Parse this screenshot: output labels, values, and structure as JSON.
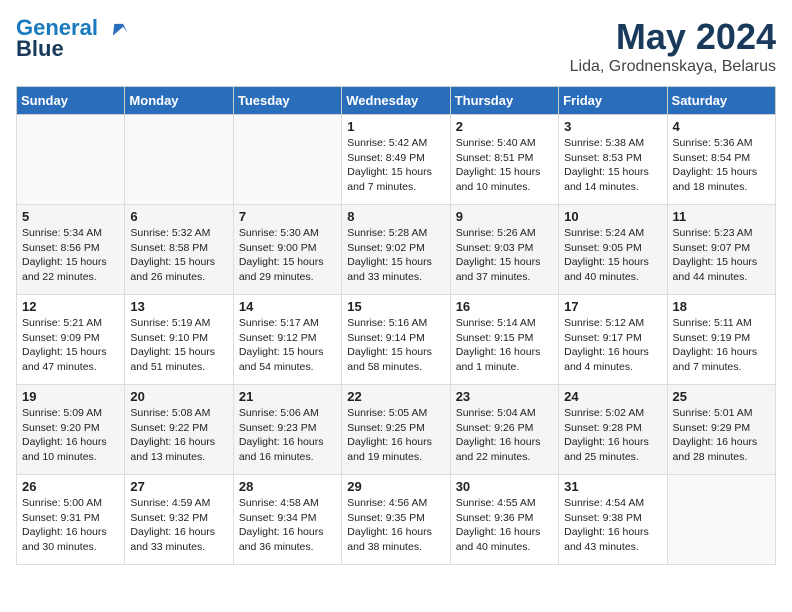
{
  "logo": {
    "line1": "General",
    "line2": "Blue"
  },
  "title": "May 2024",
  "location": "Lida, Grodnenskaya, Belarus",
  "headers": [
    "Sunday",
    "Monday",
    "Tuesday",
    "Wednesday",
    "Thursday",
    "Friday",
    "Saturday"
  ],
  "weeks": [
    [
      {
        "num": "",
        "info": ""
      },
      {
        "num": "",
        "info": ""
      },
      {
        "num": "",
        "info": ""
      },
      {
        "num": "1",
        "info": "Sunrise: 5:42 AM\nSunset: 8:49 PM\nDaylight: 15 hours\nand 7 minutes."
      },
      {
        "num": "2",
        "info": "Sunrise: 5:40 AM\nSunset: 8:51 PM\nDaylight: 15 hours\nand 10 minutes."
      },
      {
        "num": "3",
        "info": "Sunrise: 5:38 AM\nSunset: 8:53 PM\nDaylight: 15 hours\nand 14 minutes."
      },
      {
        "num": "4",
        "info": "Sunrise: 5:36 AM\nSunset: 8:54 PM\nDaylight: 15 hours\nand 18 minutes."
      }
    ],
    [
      {
        "num": "5",
        "info": "Sunrise: 5:34 AM\nSunset: 8:56 PM\nDaylight: 15 hours\nand 22 minutes."
      },
      {
        "num": "6",
        "info": "Sunrise: 5:32 AM\nSunset: 8:58 PM\nDaylight: 15 hours\nand 26 minutes."
      },
      {
        "num": "7",
        "info": "Sunrise: 5:30 AM\nSunset: 9:00 PM\nDaylight: 15 hours\nand 29 minutes."
      },
      {
        "num": "8",
        "info": "Sunrise: 5:28 AM\nSunset: 9:02 PM\nDaylight: 15 hours\nand 33 minutes."
      },
      {
        "num": "9",
        "info": "Sunrise: 5:26 AM\nSunset: 9:03 PM\nDaylight: 15 hours\nand 37 minutes."
      },
      {
        "num": "10",
        "info": "Sunrise: 5:24 AM\nSunset: 9:05 PM\nDaylight: 15 hours\nand 40 minutes."
      },
      {
        "num": "11",
        "info": "Sunrise: 5:23 AM\nSunset: 9:07 PM\nDaylight: 15 hours\nand 44 minutes."
      }
    ],
    [
      {
        "num": "12",
        "info": "Sunrise: 5:21 AM\nSunset: 9:09 PM\nDaylight: 15 hours\nand 47 minutes."
      },
      {
        "num": "13",
        "info": "Sunrise: 5:19 AM\nSunset: 9:10 PM\nDaylight: 15 hours\nand 51 minutes."
      },
      {
        "num": "14",
        "info": "Sunrise: 5:17 AM\nSunset: 9:12 PM\nDaylight: 15 hours\nand 54 minutes."
      },
      {
        "num": "15",
        "info": "Sunrise: 5:16 AM\nSunset: 9:14 PM\nDaylight: 15 hours\nand 58 minutes."
      },
      {
        "num": "16",
        "info": "Sunrise: 5:14 AM\nSunset: 9:15 PM\nDaylight: 16 hours\nand 1 minute."
      },
      {
        "num": "17",
        "info": "Sunrise: 5:12 AM\nSunset: 9:17 PM\nDaylight: 16 hours\nand 4 minutes."
      },
      {
        "num": "18",
        "info": "Sunrise: 5:11 AM\nSunset: 9:19 PM\nDaylight: 16 hours\nand 7 minutes."
      }
    ],
    [
      {
        "num": "19",
        "info": "Sunrise: 5:09 AM\nSunset: 9:20 PM\nDaylight: 16 hours\nand 10 minutes."
      },
      {
        "num": "20",
        "info": "Sunrise: 5:08 AM\nSunset: 9:22 PM\nDaylight: 16 hours\nand 13 minutes."
      },
      {
        "num": "21",
        "info": "Sunrise: 5:06 AM\nSunset: 9:23 PM\nDaylight: 16 hours\nand 16 minutes."
      },
      {
        "num": "22",
        "info": "Sunrise: 5:05 AM\nSunset: 9:25 PM\nDaylight: 16 hours\nand 19 minutes."
      },
      {
        "num": "23",
        "info": "Sunrise: 5:04 AM\nSunset: 9:26 PM\nDaylight: 16 hours\nand 22 minutes."
      },
      {
        "num": "24",
        "info": "Sunrise: 5:02 AM\nSunset: 9:28 PM\nDaylight: 16 hours\nand 25 minutes."
      },
      {
        "num": "25",
        "info": "Sunrise: 5:01 AM\nSunset: 9:29 PM\nDaylight: 16 hours\nand 28 minutes."
      }
    ],
    [
      {
        "num": "26",
        "info": "Sunrise: 5:00 AM\nSunset: 9:31 PM\nDaylight: 16 hours\nand 30 minutes."
      },
      {
        "num": "27",
        "info": "Sunrise: 4:59 AM\nSunset: 9:32 PM\nDaylight: 16 hours\nand 33 minutes."
      },
      {
        "num": "28",
        "info": "Sunrise: 4:58 AM\nSunset: 9:34 PM\nDaylight: 16 hours\nand 36 minutes."
      },
      {
        "num": "29",
        "info": "Sunrise: 4:56 AM\nSunset: 9:35 PM\nDaylight: 16 hours\nand 38 minutes."
      },
      {
        "num": "30",
        "info": "Sunrise: 4:55 AM\nSunset: 9:36 PM\nDaylight: 16 hours\nand 40 minutes."
      },
      {
        "num": "31",
        "info": "Sunrise: 4:54 AM\nSunset: 9:38 PM\nDaylight: 16 hours\nand 43 minutes."
      },
      {
        "num": "",
        "info": ""
      }
    ]
  ]
}
